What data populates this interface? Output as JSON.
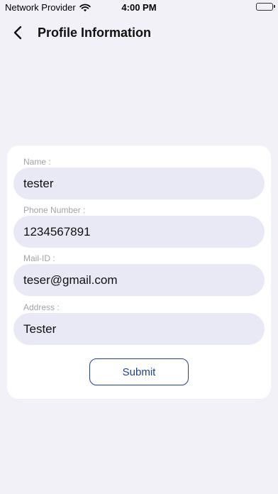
{
  "status_bar": {
    "carrier": "Network Provider",
    "time": "4:00 PM"
  },
  "header": {
    "title": "Profile Information"
  },
  "form": {
    "fields": [
      {
        "label": "Name :",
        "value": "tester"
      },
      {
        "label": "Phone Number :",
        "value": "1234567891"
      },
      {
        "label": "Mail-ID :",
        "value": "teser@gmail.com"
      },
      {
        "label": "Address :",
        "value": "Tester"
      }
    ],
    "submit_label": "Submit"
  },
  "colors": {
    "background": "#f1f1f7",
    "card": "#ffffff",
    "input_fill": "#e9e9f5",
    "accent": "#1f3f8c",
    "label": "#a2a2aa"
  }
}
